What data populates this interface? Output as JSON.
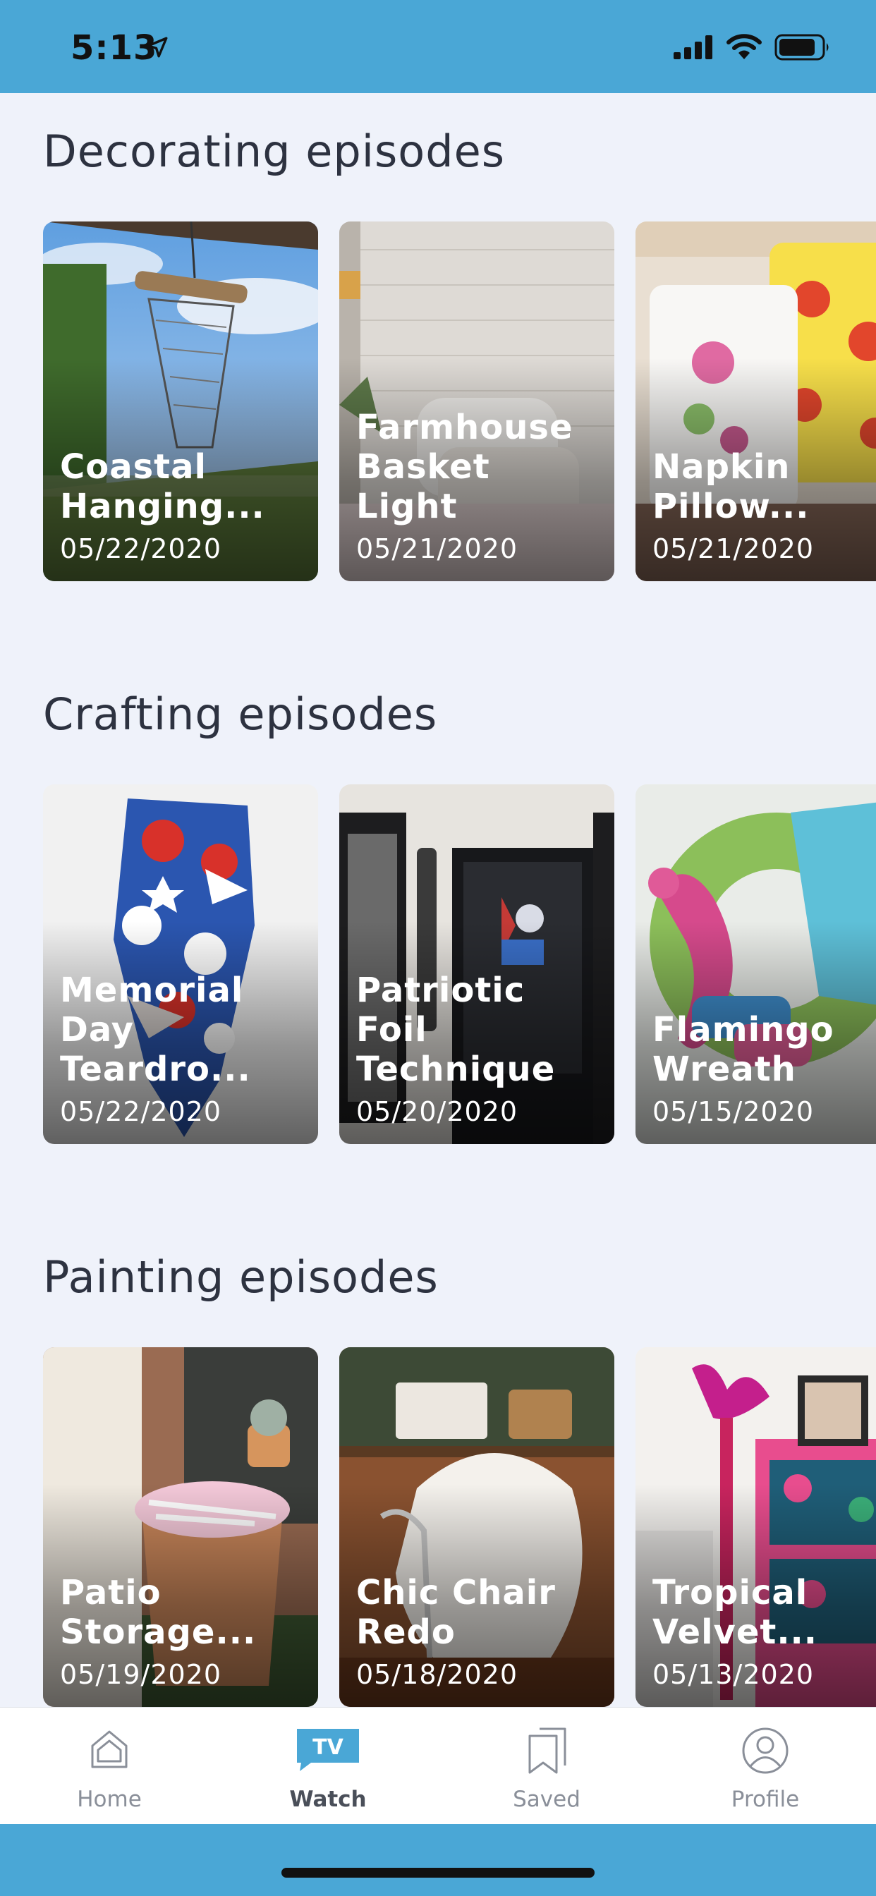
{
  "status_bar": {
    "time": "5:13",
    "background": "#4aa7d6"
  },
  "sections": [
    {
      "title": "Decorating episodes",
      "cards": [
        {
          "title": "Coastal\nHanging...",
          "date": "05/22/2020"
        },
        {
          "title": "Farmhouse\nBasket Light",
          "date": "05/21/2020"
        },
        {
          "title": "Napkin\nPillow...",
          "date": "05/21/2020"
        }
      ]
    },
    {
      "title": "Crafting episodes",
      "cards": [
        {
          "title": "Memorial\nDay Teardro...",
          "date": "05/22/2020"
        },
        {
          "title": "Patriotic Foil\nTechnique",
          "date": "05/20/2020"
        },
        {
          "title": "Flamingo\nWreath",
          "date": "05/15/2020"
        }
      ]
    },
    {
      "title": "Painting episodes",
      "cards": [
        {
          "title": "Patio\nStorage...",
          "date": "05/19/2020"
        },
        {
          "title": "Chic Chair\nRedo",
          "date": "05/18/2020"
        },
        {
          "title": "Tropical\nVelvet...",
          "date": "05/13/2020"
        }
      ]
    }
  ],
  "tab_bar": {
    "tabs": [
      {
        "label": "Home",
        "icon": "home-icon"
      },
      {
        "label": "Watch",
        "icon": "tv-icon",
        "badge": "TV",
        "active": true
      },
      {
        "label": "Saved",
        "icon": "bookmark-icon"
      },
      {
        "label": "Profile",
        "icon": "profile-icon"
      }
    ],
    "accent": "#4aa7d6"
  }
}
